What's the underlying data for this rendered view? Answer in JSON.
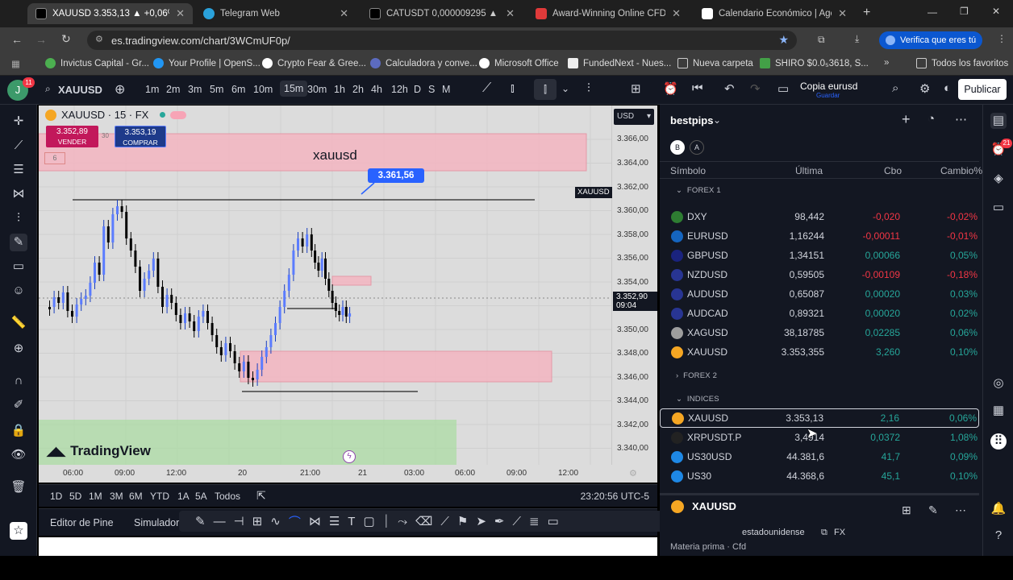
{
  "tabs": [
    {
      "label": "XAUUSD 3.353,13 ▲ +0,06% Co",
      "icon_color": "#f5a623",
      "active": true
    },
    {
      "label": "Telegram Web",
      "icon_color": "#2aa1da"
    },
    {
      "label": "CATUSDT 0,000009295 ▲ +1,0",
      "icon_color": "#ffffff"
    },
    {
      "label": "Award-Winning Online CFD Br",
      "icon_color": "#e03a3a"
    },
    {
      "label": "Calendario Económico | Agend",
      "icon_color": "#ffffff"
    }
  ],
  "browser": {
    "url": "es.tradingview.com/chart/3WCmUF0p/",
    "verify": "Verifica que eres tú"
  },
  "bookmarks": [
    "Invictus Capital - Gr...",
    "Your Profile | OpenS...",
    "Crypto Fear & Gree...",
    "Calculadora y conve...",
    "Microsoft Office",
    "FundedNext - Nues...",
    "Nueva carpeta",
    "SHIRO $0.0₅3618, S...",
    "Todos los favoritos"
  ],
  "toolbar": {
    "symbol": "XAUUSD",
    "timeframes": [
      "1m",
      "2m",
      "3m",
      "5m",
      "6m",
      "10m",
      "15m",
      "30m",
      "1h",
      "2h",
      "4h",
      "12h",
      "D",
      "S",
      "M"
    ],
    "selected_tf": "15m",
    "layout_name": "Copia eurusd",
    "layout_status": "Guardar",
    "publish": "Publicar",
    "avatar": "J",
    "badge": "11"
  },
  "chart": {
    "title": "XAUUSD · 15 · FX",
    "currency": "USD",
    "sell_price": "3.352,89",
    "sell_label": "VENDER",
    "spread": "30",
    "buy_price": "3.353,19",
    "buy_label": "COMPRAR",
    "indicator_count": "6",
    "zone_label": "xauusd",
    "alert_label": "3.361,56",
    "last_price_label": "XAUUSD",
    "last_price": "3.352,90",
    "countdown": "09:04",
    "watermark": "TradingView",
    "price_ticks": [
      "3.366,00",
      "3.364,00",
      "3.362,00",
      "3.360,00",
      "3.358,00",
      "3.356,00",
      "3.354,00",
      "3.352,00",
      "3.350,00",
      "3.348,00",
      "3.346,00",
      "3.344,00",
      "3.342,00",
      "3.340,00"
    ],
    "time_ticks": [
      "06:00",
      "09:00",
      "12:00",
      "20",
      "21:00",
      "21",
      "03:00",
      "06:00",
      "09:00",
      "12:00"
    ]
  },
  "range": {
    "buttons": [
      "1D",
      "5D",
      "1M",
      "3M",
      "6M",
      "YTD",
      "1A",
      "5A",
      "Todos"
    ],
    "clock": "23:20:56 UTC-5"
  },
  "editor": {
    "pine": "Editor de Pine",
    "sim": "Simulador"
  },
  "watchlist": {
    "name": "bestpips",
    "headers": {
      "symbol": "Símbolo",
      "last": "Última",
      "chg": "Cbo",
      "pct": "Cambio%"
    },
    "groups": {
      "forex1": "FOREX 1",
      "forex2": "FOREX 2",
      "indices": "INDICES"
    },
    "rows": [
      {
        "sym": "DXY",
        "last": "98,442",
        "chg": "-0,020",
        "pct": "-0,02%",
        "dir": "neg",
        "logo": "#2e7d32"
      },
      {
        "sym": "EURUSD",
        "last": "1,16244",
        "chg": "-0,00011",
        "pct": "-0,01%",
        "dir": "neg",
        "logo": "#1565c0"
      },
      {
        "sym": "GBPUSD",
        "last": "1,34151",
        "chg": "0,00066",
        "pct": "0,05%",
        "dir": "pos",
        "logo": "#1a237e"
      },
      {
        "sym": "NZDUSD",
        "last": "0,59505",
        "chg": "-0,00109",
        "pct": "-0,18%",
        "dir": "neg",
        "logo": "#283593"
      },
      {
        "sym": "AUDUSD",
        "last": "0,65087",
        "chg": "0,00020",
        "pct": "0,03%",
        "dir": "pos",
        "logo": "#283593"
      },
      {
        "sym": "AUDCAD",
        "last": "0,89321",
        "chg": "0,00020",
        "pct": "0,02%",
        "dir": "pos",
        "logo": "#283593"
      },
      {
        "sym": "XAGUSD",
        "last": "38,18785",
        "chg": "0,02285",
        "pct": "0,06%",
        "dir": "pos",
        "logo": "#9e9e9e"
      },
      {
        "sym": "XAUUSD",
        "last": "3.353,355",
        "chg": "3,260",
        "pct": "0,10%",
        "dir": "pos",
        "logo": "#f5a623"
      }
    ],
    "index_rows": [
      {
        "sym": "XAUUSD",
        "last": "3.353,13",
        "chg": "2,16",
        "pct": "0,06%",
        "dir": "pos",
        "logo": "#f5a623",
        "selected": true
      },
      {
        "sym": "XRPUSDT.P",
        "last": "3,4914",
        "chg": "0,0372",
        "pct": "1,08%",
        "dir": "pos",
        "logo": "#222222"
      },
      {
        "sym": "US30USD",
        "last": "44.381,6",
        "chg": "41,7",
        "pct": "0,09%",
        "dir": "pos",
        "logo": "#1e88e5"
      },
      {
        "sym": "US30",
        "last": "44.368,6",
        "chg": "45,1",
        "pct": "0,10%",
        "dir": "pos",
        "logo": "#1e88e5"
      }
    ],
    "detail": {
      "symbol": "XAUUSD",
      "desc": "estadounidense",
      "market": "FX",
      "type": "Materia prima · Cfd"
    }
  }
}
